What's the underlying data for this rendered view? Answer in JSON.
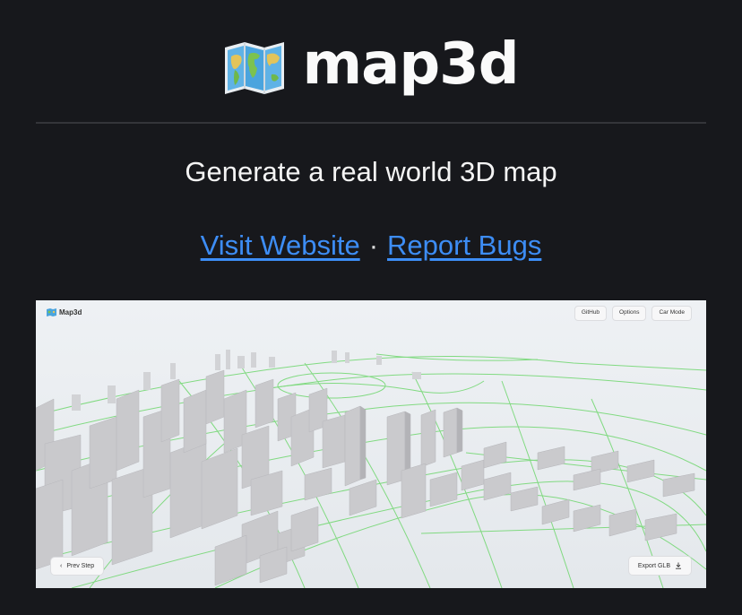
{
  "header": {
    "icon": "world-map-icon",
    "title": "map3d",
    "subtitle": "Generate a real world 3D map"
  },
  "links": {
    "website_label": "Visit Website",
    "separator": "·",
    "bugs_label": "Report Bugs"
  },
  "preview": {
    "app_name": "Map3d",
    "buttons": {
      "github": "GitHub",
      "options": "Options",
      "car_mode": "Car Mode"
    },
    "prev_step": "Prev Step",
    "prev_icon": "‹",
    "export": "Export GLB",
    "export_icon": "download-icon"
  },
  "colors": {
    "background": "#17181c",
    "link": "#3d8df5",
    "road": "#7cd97c",
    "building": "#c9c9cc"
  }
}
